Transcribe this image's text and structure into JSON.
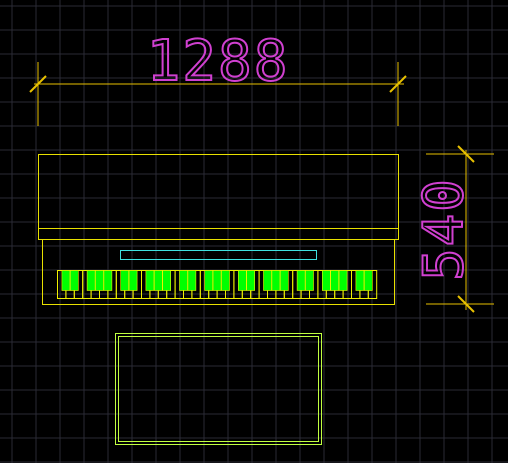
{
  "drawing": {
    "background": "#000000",
    "grid_color": "#2a2a35",
    "horizontal_dimension": {
      "text": "1288",
      "text_color": "#d040d0",
      "line_color": "#e8c000"
    },
    "vertical_dimension": {
      "text": "540",
      "text_color": "#d040d0",
      "line_color": "#e8c000"
    },
    "piano": {
      "outline_color": "#e8e000",
      "music_rest_color": "#40e0e0",
      "white_key_color": "#f0f000",
      "black_key_fill": "#00ff00",
      "white_key_count": 38,
      "black_key_pattern": [
        1,
        1,
        0,
        1,
        1,
        1,
        0
      ]
    },
    "bench": {
      "outline_color": "#c0ff40"
    }
  }
}
